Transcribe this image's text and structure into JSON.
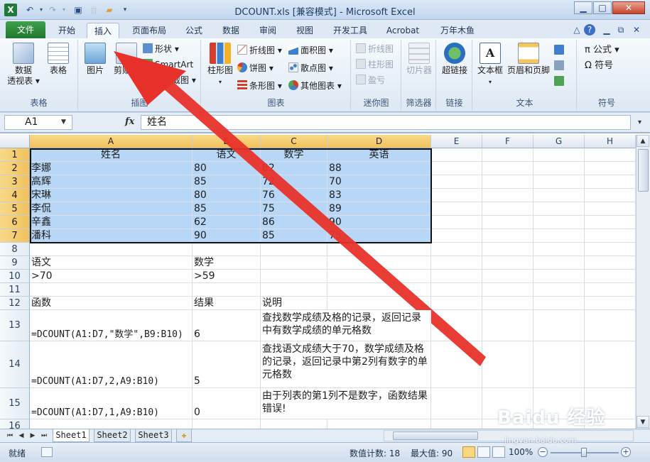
{
  "window": {
    "title": "DCOUNT.xls [兼容模式] - Microsoft Excel",
    "app_icon": "X",
    "qat_icons": [
      "undo-icon",
      "redo-icon",
      "save-icon",
      "new-icon",
      "open-icon",
      "customize-icon"
    ],
    "controls": {
      "minimize": "▁",
      "maximize": "□",
      "close": "✕"
    }
  },
  "ribbon_tabs": [
    {
      "label": "文件"
    },
    {
      "label": "开始"
    },
    {
      "label": "插入",
      "active": true
    },
    {
      "label": "页面布局"
    },
    {
      "label": "公式"
    },
    {
      "label": "数据"
    },
    {
      "label": "审阅"
    },
    {
      "label": "视图"
    },
    {
      "label": "开发工具"
    },
    {
      "label": "Acrobat"
    },
    {
      "label": "万年木鱼"
    }
  ],
  "ribbon_groups": {
    "tables": {
      "label": "表格",
      "pivot_line1": "数据",
      "pivot_line2": "透视表 ▾",
      "table": "表格"
    },
    "illustrations": {
      "label": "插图",
      "picture": "图片",
      "clipart": "剪贴画",
      "shapes": "形状 ▾",
      "smartart": "SmartArt",
      "screenshot": "屏幕截图 ▾"
    },
    "charts": {
      "label": "图表",
      "column": "柱形图",
      "line": "折线图 ▾",
      "pie": "饼图 ▾",
      "bar": "条形图 ▾",
      "area": "面积图 ▾",
      "scatter": "散点图 ▾",
      "other": "其他图表 ▾"
    },
    "sparklines": {
      "label": "迷你图",
      "line": "折线图",
      "column": "柱形图",
      "winloss": "盈亏"
    },
    "filter": {
      "label": "筛选器",
      "slicer": "切片器"
    },
    "links": {
      "label": "链接",
      "hyperlink": "超链接"
    },
    "text": {
      "label": "文本",
      "textbox": "文本框",
      "header_footer": "页眉和页脚"
    },
    "symbols": {
      "label": "符号",
      "equation": "π 公式 ▾",
      "symbol": "Ω 符号"
    }
  },
  "formula_bar": {
    "name_box": "A1",
    "fx": "fx",
    "content": "姓名"
  },
  "columns": [
    "A",
    "B",
    "C",
    "D",
    "E",
    "F",
    "G",
    "H"
  ],
  "rows": [
    "1",
    "2",
    "3",
    "4",
    "5",
    "6",
    "7",
    "8",
    "9",
    "10",
    "11",
    "12",
    "13",
    "14",
    "15",
    "16"
  ],
  "cells": {
    "A1": "姓名",
    "B1": "语文",
    "C1": "数学",
    "D1": "英语",
    "A2": "李娜",
    "B2": "80",
    "C2": "82",
    "D2": "88",
    "A3": "高辉",
    "B3": "85",
    "C3": "72",
    "D3": "70",
    "A4": "宋琳",
    "B4": "80",
    "C4": "76",
    "D4": "83",
    "A5": "李侃",
    "B5": "85",
    "C5": "75",
    "D5": "89",
    "A6": "辛鑫",
    "B6": "62",
    "C6": "86",
    "D6": "90",
    "A7": "潘科",
    "B7": "90",
    "C7": "85",
    "D7": "75",
    "A9": "语文",
    "B9": "数学",
    "A10": ">70",
    "B10": ">59",
    "A12": "函数",
    "B12": "结果",
    "C12": "说明",
    "A13": "=DCOUNT(A1:D7,\"数学\",B9:B10)",
    "B13": "6",
    "C13": "查找数学成绩及格的记录，返回记录中有数学成绩的单元格数",
    "A14": "=DCOUNT(A1:D7,2,A9:B10)",
    "B14": "5",
    "C14": "查找语文成绩大于70，数学成绩及格的记录，返回记录中第2列有数字的单元格数",
    "A15": "=DCOUNT(A1:D7,1,A9:B10)",
    "B15": "0",
    "C15": "由于列表的第1列不是数字，函数结果错误!"
  },
  "sheets": [
    "Sheet1",
    "Sheet2",
    "Sheet3"
  ],
  "active_sheet": "Sheet1",
  "status": {
    "mode": "就绪",
    "count": "数值计数: 18",
    "max": "最大值: 90",
    "zoom": "100%"
  },
  "watermark": {
    "main": "Baidu 经验",
    "sub": "jingyan.baidu.com"
  },
  "colors": {
    "selection": "#b8d6f5",
    "arrow": "#e8312a",
    "file_tab": "#2a8a3a"
  }
}
